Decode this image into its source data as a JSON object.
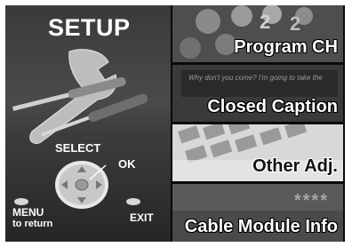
{
  "setup": {
    "title": "SETUP",
    "select_label": "SELECT",
    "ok_label": "OK",
    "menu_label": "MENU",
    "menu_sublabel": "to return",
    "exit_label": "EXIT"
  },
  "menu": {
    "items": [
      {
        "label": "Program CH",
        "background_text": ""
      },
      {
        "label": "Closed Caption",
        "background_text": "Why don't you come? I'm going to take the"
      },
      {
        "label": "Other Adj.",
        "background_text": ""
      },
      {
        "label": "Cable Module Info",
        "background_text": "****"
      }
    ]
  },
  "colors": {
    "frame": "#0a0a0a",
    "text": "#ffffff"
  }
}
